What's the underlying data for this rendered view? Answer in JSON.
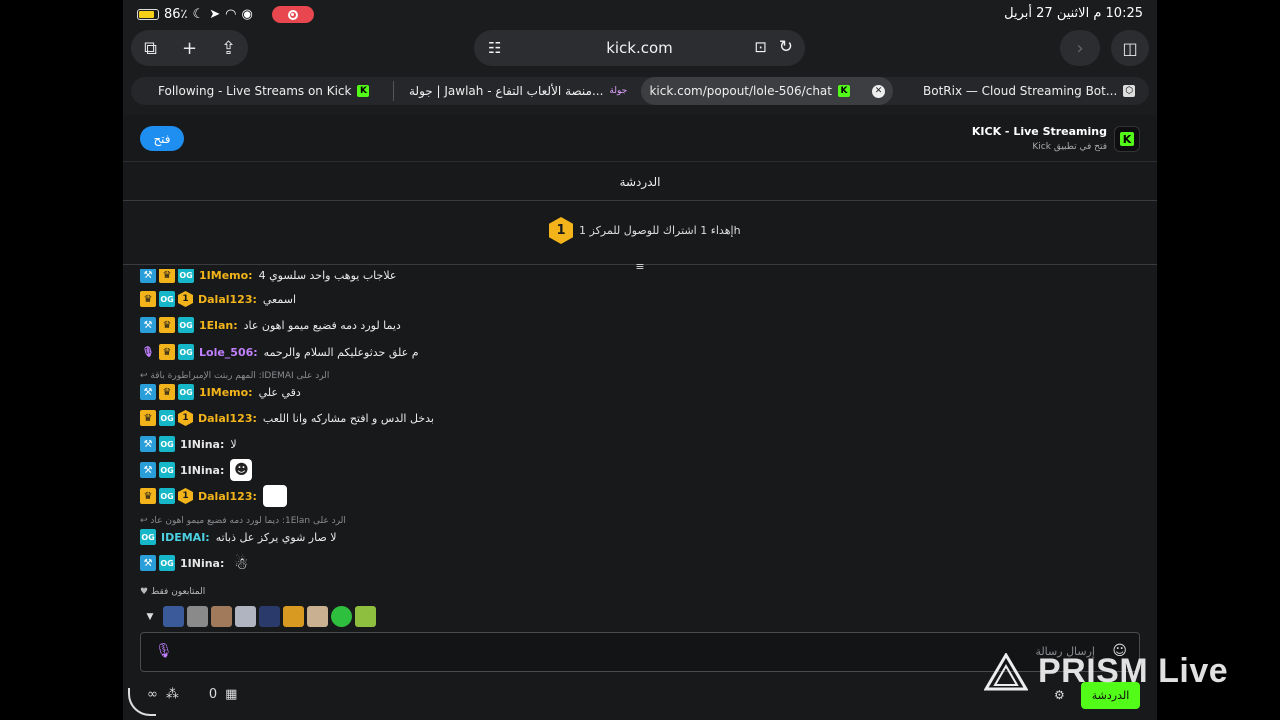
{
  "status": {
    "battery": "86٪",
    "time_date": "10:25 م   الاثنين 27 أبريل"
  },
  "browser": {
    "url": "kick.com",
    "tabs": [
      {
        "title": "Following - Live Streams on Kick"
      },
      {
        "title": "جولة | Jawlah - منصة الألعاب التفاع..."
      },
      {
        "title": "kick.com/popout/lole-506/chat"
      },
      {
        "title": "BotRix — Cloud Streaming Bot..."
      }
    ]
  },
  "banner": {
    "open_label": "فتح",
    "app_title": "KICK - Live Streaming",
    "app_subtitle": "فتح في تطبيق Kick"
  },
  "chat": {
    "header": "الدردشة",
    "pinned": "hإهداء 1 اشتراك للوصول للمركز 1",
    "pinned_badge": "1",
    "messages": [
      {
        "user": "1IMemo:",
        "color": "#f3b41b",
        "text": "علاجاب يوهب واحد سلسوي 4"
      },
      {
        "user": "Dalal123:",
        "color": "#f3b41b",
        "text": "اسمعي"
      },
      {
        "user": "1Elan:",
        "color": "#f3b41b",
        "text": "ديما لورد دمه فضيع ميمو اهون عاد"
      },
      {
        "user": "Lole_506:",
        "color": "#c080ff",
        "text": "م علق حدثوعليكم السلام والرحمه"
      },
      {
        "reply": "الرد على IDEMAI: المهم ربتت الإمبراطورة باقة"
      },
      {
        "user": "1IMemo:",
        "color": "#f3b41b",
        "text": "دقي علي"
      },
      {
        "user": "Dalal123:",
        "color": "#f3b41b",
        "text": "بدخل الدس و افتح مشاركه وانا اللعب"
      },
      {
        "user": "1INina:",
        "color": "#e6e6e6",
        "text": "لا"
      },
      {
        "user": "1INina:",
        "color": "#e6e6e6",
        "text": ""
      },
      {
        "user": "Dalal123:",
        "color": "#f3b41b",
        "text": ""
      },
      {
        "reply": "الرد على 1Elan: ديما لورد دمه فضيع ميمو اهون عاد"
      },
      {
        "user": "IDEMAI:",
        "color": "#4dd0e1",
        "text": "لا صار شوي يركز عل ذباته"
      },
      {
        "user": "1INina:",
        "color": "#e6e6e6",
        "text": ""
      }
    ],
    "followers_only": "المتابعون فقط",
    "input_placeholder": "إرسال رسالة",
    "send_label": "الدردشة",
    "counter": "0"
  },
  "watermark": "PRISM Live"
}
